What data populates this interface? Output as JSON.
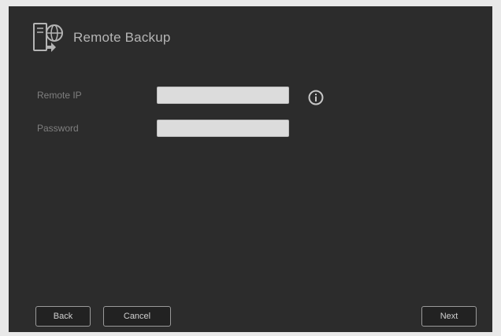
{
  "dialog": {
    "title": "Remote Backup",
    "icon": "remote-backup-icon"
  },
  "form": {
    "remote_ip": {
      "label": "Remote IP",
      "value": "",
      "placeholder": ""
    },
    "password": {
      "label": "Password",
      "value": "",
      "placeholder": ""
    },
    "info_icon": "info-icon"
  },
  "buttons": {
    "back": "Back",
    "cancel": "Cancel",
    "next": "Next"
  }
}
